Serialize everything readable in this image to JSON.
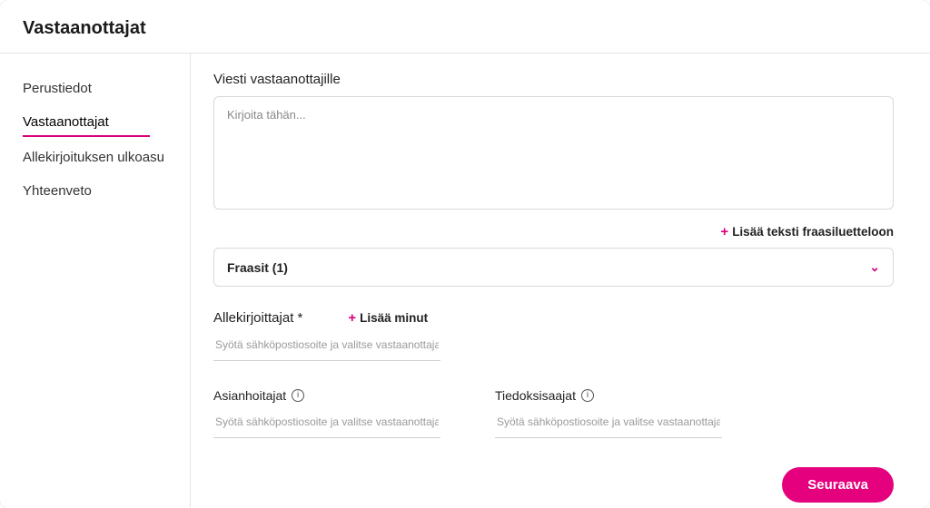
{
  "header": {
    "title": "Vastaanottajat"
  },
  "sidebar": {
    "items": [
      {
        "label": "Perustiedot",
        "active": false
      },
      {
        "label": "Vastaanottajat",
        "active": true
      },
      {
        "label": "Allekirjoituksen ulkoasu",
        "active": false
      },
      {
        "label": "Yhteenveto",
        "active": false
      }
    ]
  },
  "main": {
    "message_label": "Viesti vastaanottajille",
    "message_placeholder": "Kirjoita tähän...",
    "add_phrase_label": "Lisää teksti fraasiluetteloon",
    "phrases_select": "Fraasit (1)",
    "signers_label": "Allekirjoittajat *",
    "add_me_label": "Lisää minut",
    "signer_placeholder": "Syötä sähköpostiosoite ja valitse vastaanottaja",
    "handlers_label": "Asianhoitajat",
    "handlers_placeholder": "Syötä sähköpostiosoite ja valitse vastaanottaja",
    "cc_label": "Tiedoksisaajat",
    "cc_placeholder": "Syötä sähköpostiosoite ja valitse vastaanottaja",
    "next_button": "Seuraava"
  }
}
